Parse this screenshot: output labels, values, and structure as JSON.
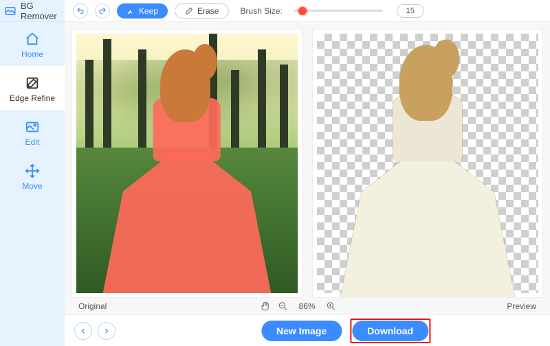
{
  "app": {
    "title": "BG Remover"
  },
  "sidebar": {
    "items": [
      {
        "label": "Home"
      },
      {
        "label": "Edge Refine"
      },
      {
        "label": "Edit"
      },
      {
        "label": "Move"
      }
    ]
  },
  "toolbar": {
    "keep_label": "Keep",
    "erase_label": "Erase",
    "brush_label": "Brush Size:",
    "brush_value": "15",
    "slider_percent": 10
  },
  "panels": {
    "original_label": "Original",
    "preview_label": "Preview"
  },
  "zoom": {
    "value": "86%"
  },
  "footer": {
    "new_image_label": "New Image",
    "download_label": "Download"
  }
}
